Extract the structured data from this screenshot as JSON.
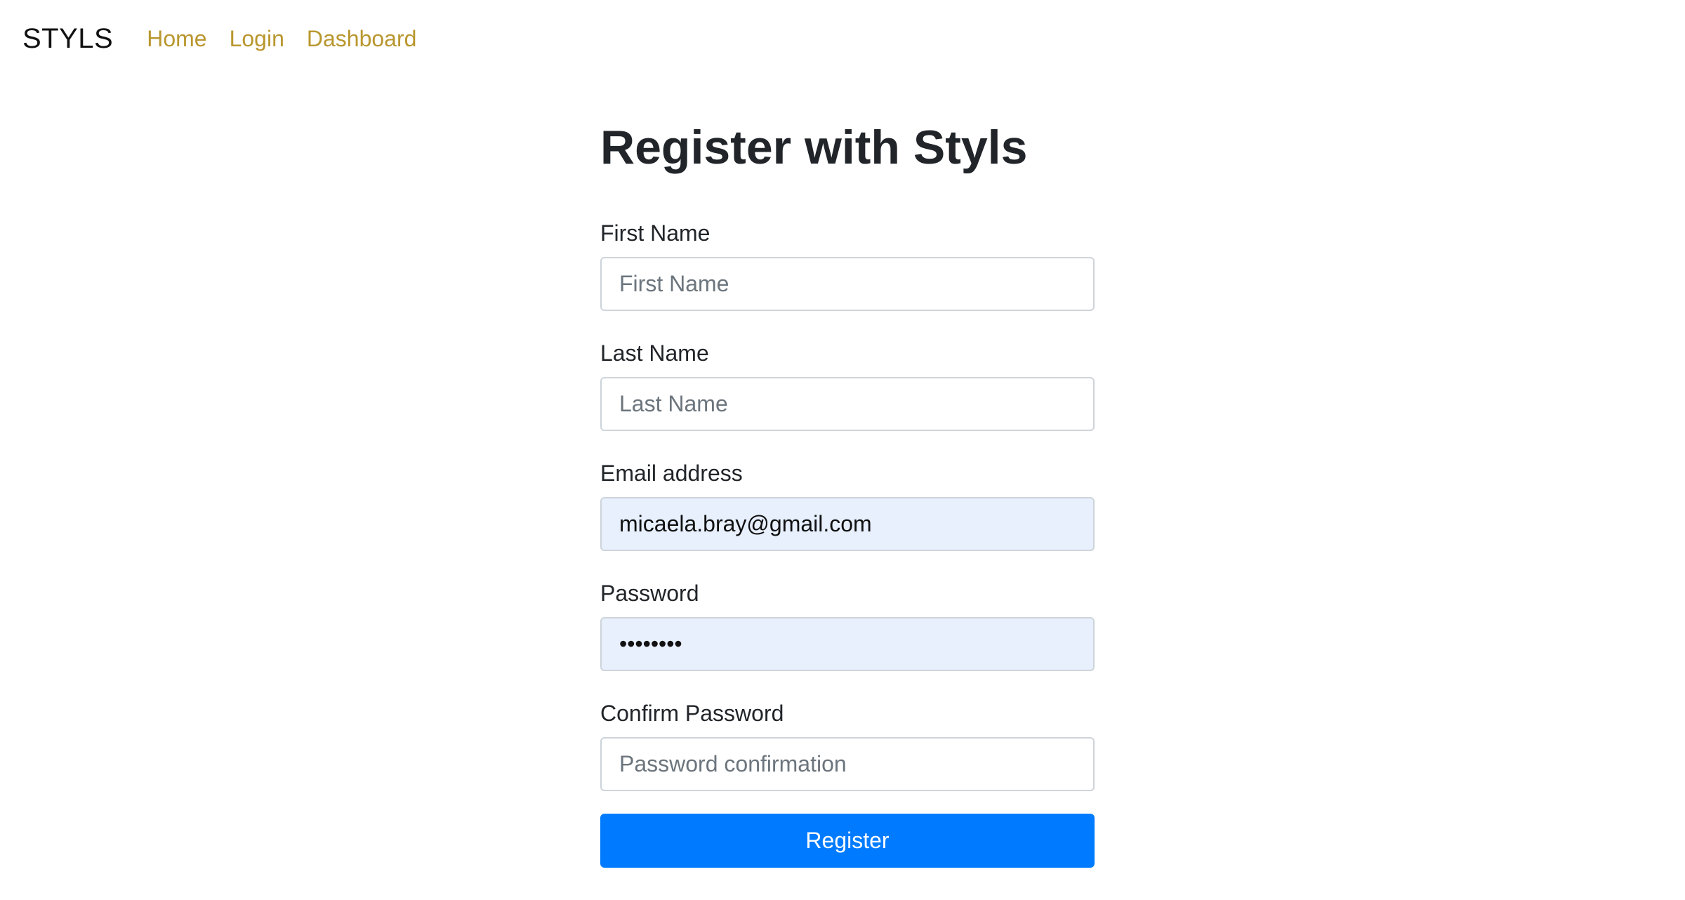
{
  "navbar": {
    "brand": "STYLS",
    "links": [
      {
        "label": "Home"
      },
      {
        "label": "Login"
      },
      {
        "label": "Dashboard"
      }
    ]
  },
  "colors": {
    "nav_link": "#b9972f",
    "primary_button": "#007bff",
    "autofill_background": "#e8f0fe",
    "input_border": "#ced4da"
  },
  "form": {
    "title": "Register with Styls",
    "first_name": {
      "label": "First Name",
      "placeholder": "First Name",
      "value": ""
    },
    "last_name": {
      "label": "Last Name",
      "placeholder": "Last Name",
      "value": ""
    },
    "email": {
      "label": "Email address",
      "placeholder": "",
      "value": "micaela.bray@gmail.com"
    },
    "password": {
      "label": "Password",
      "placeholder": "",
      "value": "••••••••"
    },
    "confirm_password": {
      "label": "Confirm Password",
      "placeholder": "Password confirmation",
      "value": ""
    },
    "submit_label": "Register"
  }
}
